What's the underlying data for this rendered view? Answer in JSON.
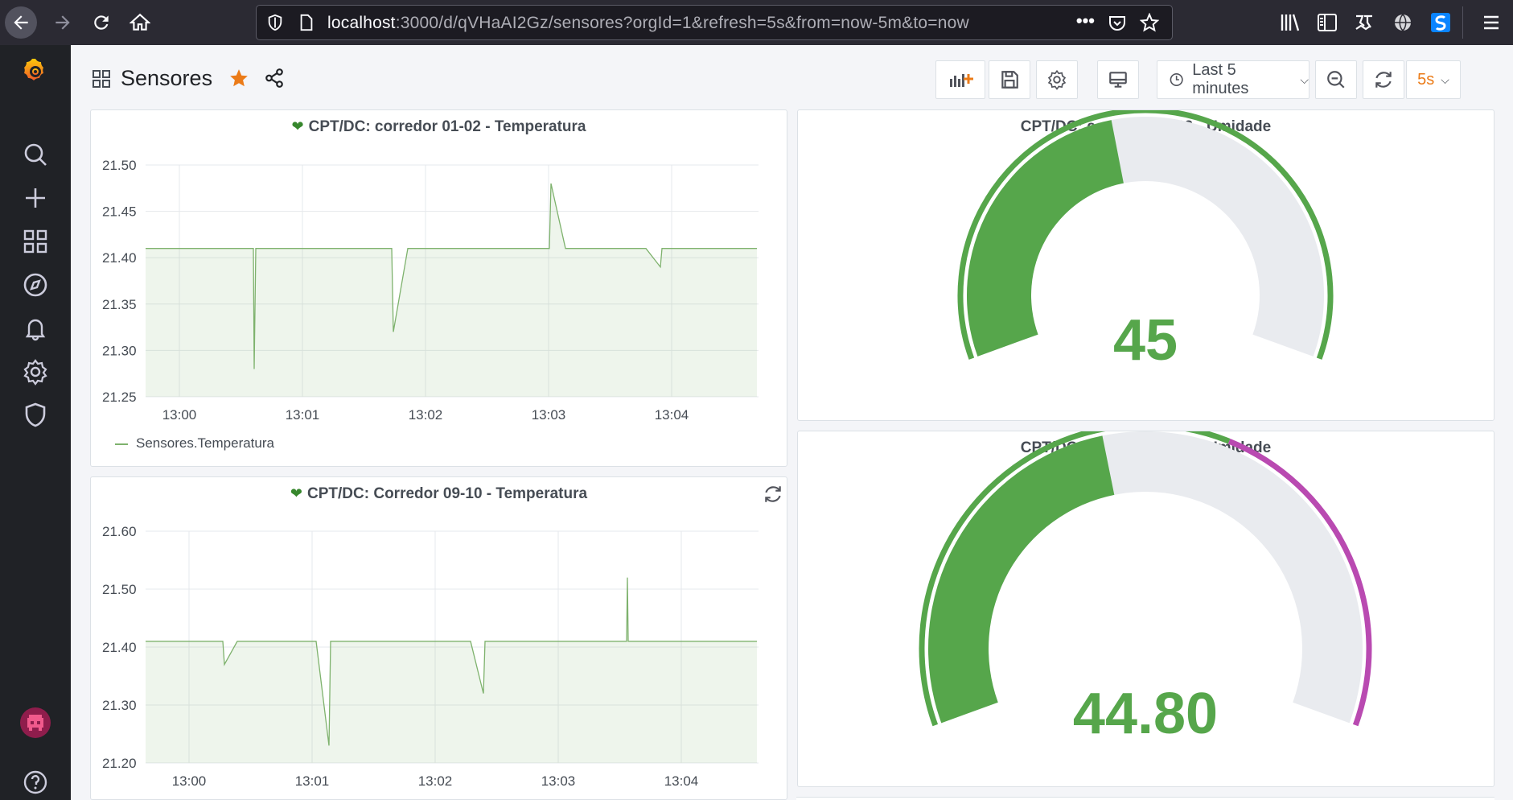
{
  "browser": {
    "url_host": "localhost",
    "url_rest": ":3000/d/qVHaAI2Gz/sensores?orgId=1&refresh=5s&from=now-5m&to=now",
    "icons": [
      "back-icon",
      "forward-icon",
      "reload-icon",
      "home-icon",
      "shield-icon",
      "page-icon",
      "more-dots-icon",
      "pocket-icon",
      "bookmark-star-icon",
      "library-icon",
      "sidebar-icon",
      "extension-icon",
      "globe-icon",
      "s-extension-icon",
      "hamburger-menu-icon"
    ],
    "url_dots": "•••"
  },
  "sidebar": {
    "icons": [
      "grafana-logo-icon",
      "search-icon",
      "plus-icon",
      "dashboards-icon",
      "explore-icon",
      "alert-bell-icon",
      "gear-icon",
      "shield-icon",
      "avatar",
      "help-icon"
    ]
  },
  "header": {
    "title": "Sensores",
    "time_range": "Last 5 minutes",
    "refresh_interval": "5s"
  },
  "panels": {
    "temp1": {
      "title": "CPT/DC: corredor 01-02 - Temperatura",
      "legend": "Sensores.Temperatura",
      "chart_data": {
        "type": "line",
        "series_name": "Sensores.Temperatura",
        "y_ticks": [
          "21.50",
          "21.45",
          "21.40",
          "21.35",
          "21.30",
          "21.25"
        ],
        "x_ticks": [
          "13:00",
          "13:01",
          "13:02",
          "13:03",
          "13:04"
        ],
        "ylim": [
          21.25,
          21.5
        ],
        "color": "#7eb26d"
      }
    },
    "temp2": {
      "title": "CPT/DC: Corredor 09-10 - Temperatura",
      "chart_data": {
        "type": "line",
        "y_ticks": [
          "21.60",
          "21.50",
          "21.40",
          "21.30",
          "21.20"
        ],
        "x_ticks": [
          "13:00",
          "13:01",
          "13:02",
          "13:03",
          "13:04"
        ],
        "ylim": [
          21.2,
          21.6
        ],
        "color": "#7eb26d"
      }
    },
    "hum1": {
      "title": "CPT/DC: corredor 01-02 - Umidade",
      "value": "45",
      "gauge_fraction": 0.45,
      "color": "#56a64b"
    },
    "hum2": {
      "title": "CPT/DC: corredor 09-10 - Umidade",
      "value": "44.80",
      "gauge_fraction": 0.448,
      "threshold_color": "#b94ab1",
      "color": "#56a64b"
    }
  }
}
